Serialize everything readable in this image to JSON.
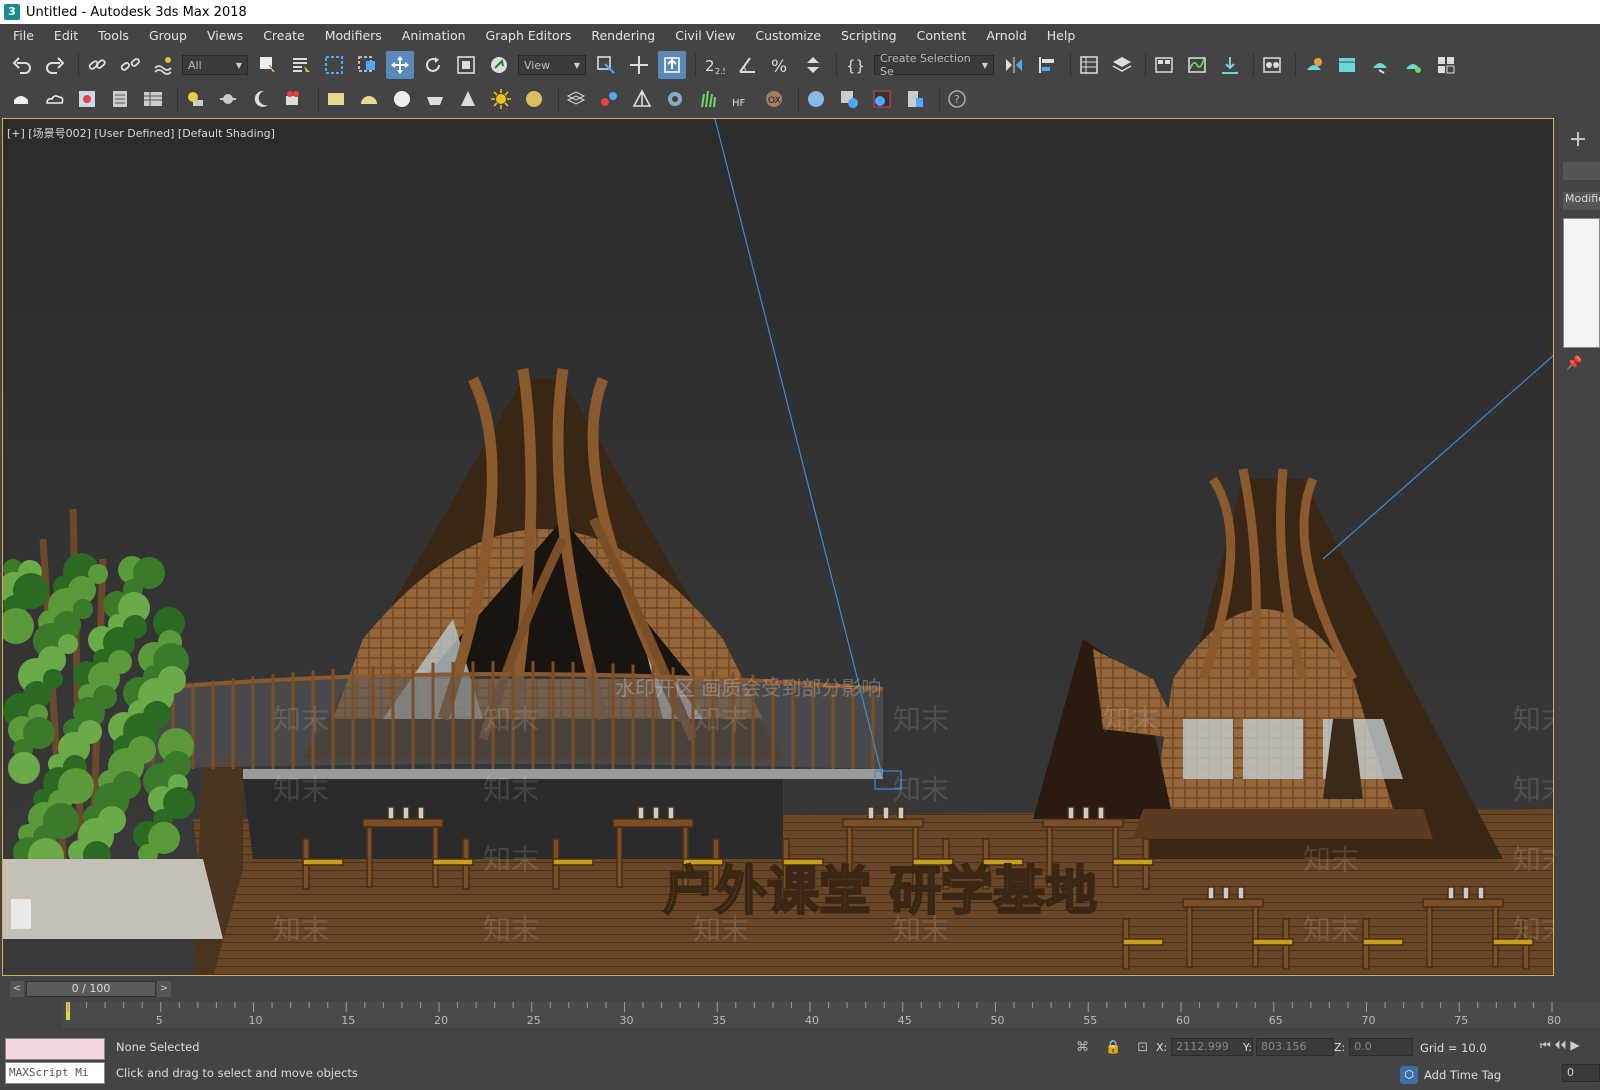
{
  "window": {
    "title": "Untitled - Autodesk 3ds Max 2018",
    "app_icon": "3"
  },
  "menu": [
    "File",
    "Edit",
    "Tools",
    "Group",
    "Views",
    "Create",
    "Modifiers",
    "Animation",
    "Graph Editors",
    "Rendering",
    "Civil View",
    "Customize",
    "Scripting",
    "Content",
    "Arnold",
    "Help"
  ],
  "toolbar": {
    "filter_dropdown": "All",
    "refcoord_dropdown": "View",
    "selection_set_dropdown": "Create Selection Se",
    "snap_label": "2.5"
  },
  "viewport": {
    "label": "[+] [场景号002] [User Defined] [Default Shading]",
    "scene_text": "户外课堂 研学基地",
    "watermark": "水印开区 画质会受到部分影响",
    "watermark_mark": "知末"
  },
  "command_panel": {
    "plus": "+",
    "modifier_label": "Modifie"
  },
  "timeline": {
    "frame_display": "0 / 100",
    "prev": "<",
    "next": ">",
    "ticks": [
      "5",
      "10",
      "15",
      "20",
      "25",
      "30",
      "35",
      "40",
      "45",
      "50",
      "55",
      "60",
      "65",
      "70",
      "75",
      "80"
    ]
  },
  "status": {
    "maxscript": "MAXScript Mi",
    "selection": "None Selected",
    "hint": "Click and drag to select and move objects",
    "x_label": "X:",
    "x_value": "2112.999",
    "y_label": "Y:",
    "y_value": "803.156",
    "z_label": "Z:",
    "z_value": "0.0",
    "grid": "Grid = 10.0",
    "add_time_tag": "Add Time Tag",
    "frame_field": "0"
  },
  "colors": {
    "viewport_border": "#d8b04a",
    "active_button": "#5a88b8",
    "wood": "#8a5a2e",
    "thatch": "#a8773f"
  }
}
